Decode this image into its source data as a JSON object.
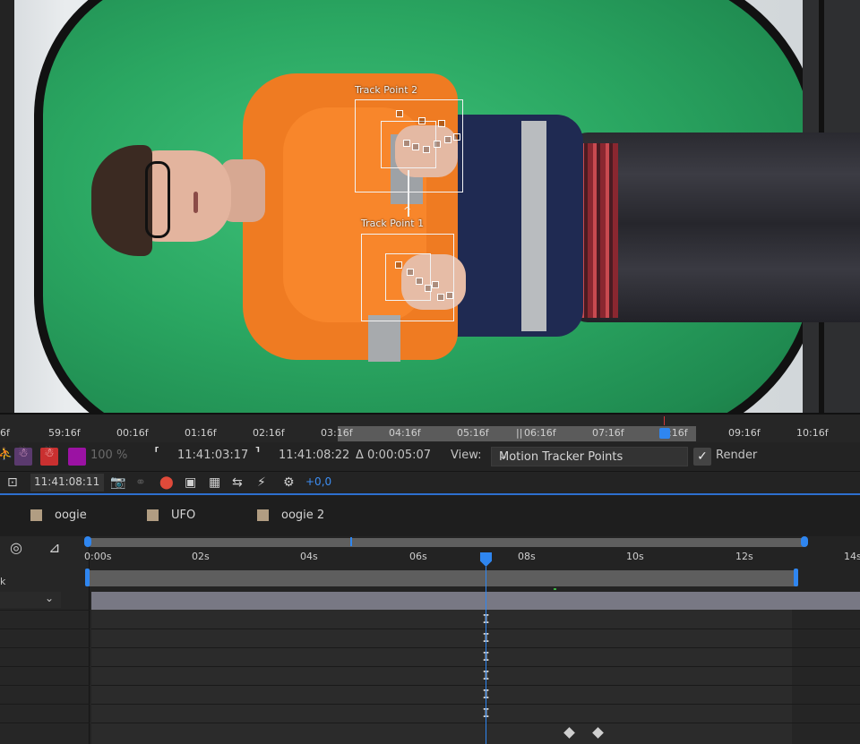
{
  "viewer": {
    "track_point_2": "Track Point 2",
    "track_point_1": "Track Point 1"
  },
  "ruler": {
    "ticks": [
      "6f",
      "59:16f",
      "00:16f",
      "01:16f",
      "02:16f",
      "03:16f",
      "04:16f",
      "05:16f",
      "06:16f",
      "07:16f",
      "08:16f",
      "09:16f",
      "10:16f"
    ],
    "cti_tick_visible": ":16f",
    "pipes": "||"
  },
  "controls": {
    "zoom": "100 %",
    "in_point": "11:41:03:17",
    "out_point": "11:41:08:22",
    "duration": "Δ 0:00:05:07",
    "view_label": "View:",
    "view_value": "Motion Tracker Points",
    "render_label": "Render",
    "current_time": "11:41:08:11",
    "exposure": "+0,0"
  },
  "layers": [
    "oogie",
    "UFO",
    "oogie 2"
  ],
  "timeline": {
    "ruler": [
      "0:00s",
      "02s",
      "04s",
      "06s",
      "08s",
      "10s",
      "12s",
      "14s"
    ],
    "left_label": "k"
  },
  "colors": {
    "accent": "#2f86f0",
    "label_chip": "#b19d82",
    "green_screen": "#2aa661",
    "jacket_orange": "#ef7b22"
  },
  "icons": [
    "puppet-icon",
    "puppet-red-icon",
    "color-swatch-icon",
    "in-point-bracket-icon",
    "out-point-bracket-icon",
    "chevron-down-icon",
    "checkbox-icon",
    "region-icon",
    "camera-icon",
    "link-icon",
    "color-channels-icon",
    "view-icon",
    "transparency-grid-icon",
    "toggle-icon",
    "fast-preview-icon",
    "exposure-icon",
    "motion-blur-icon",
    "graph-editor-icon"
  ]
}
